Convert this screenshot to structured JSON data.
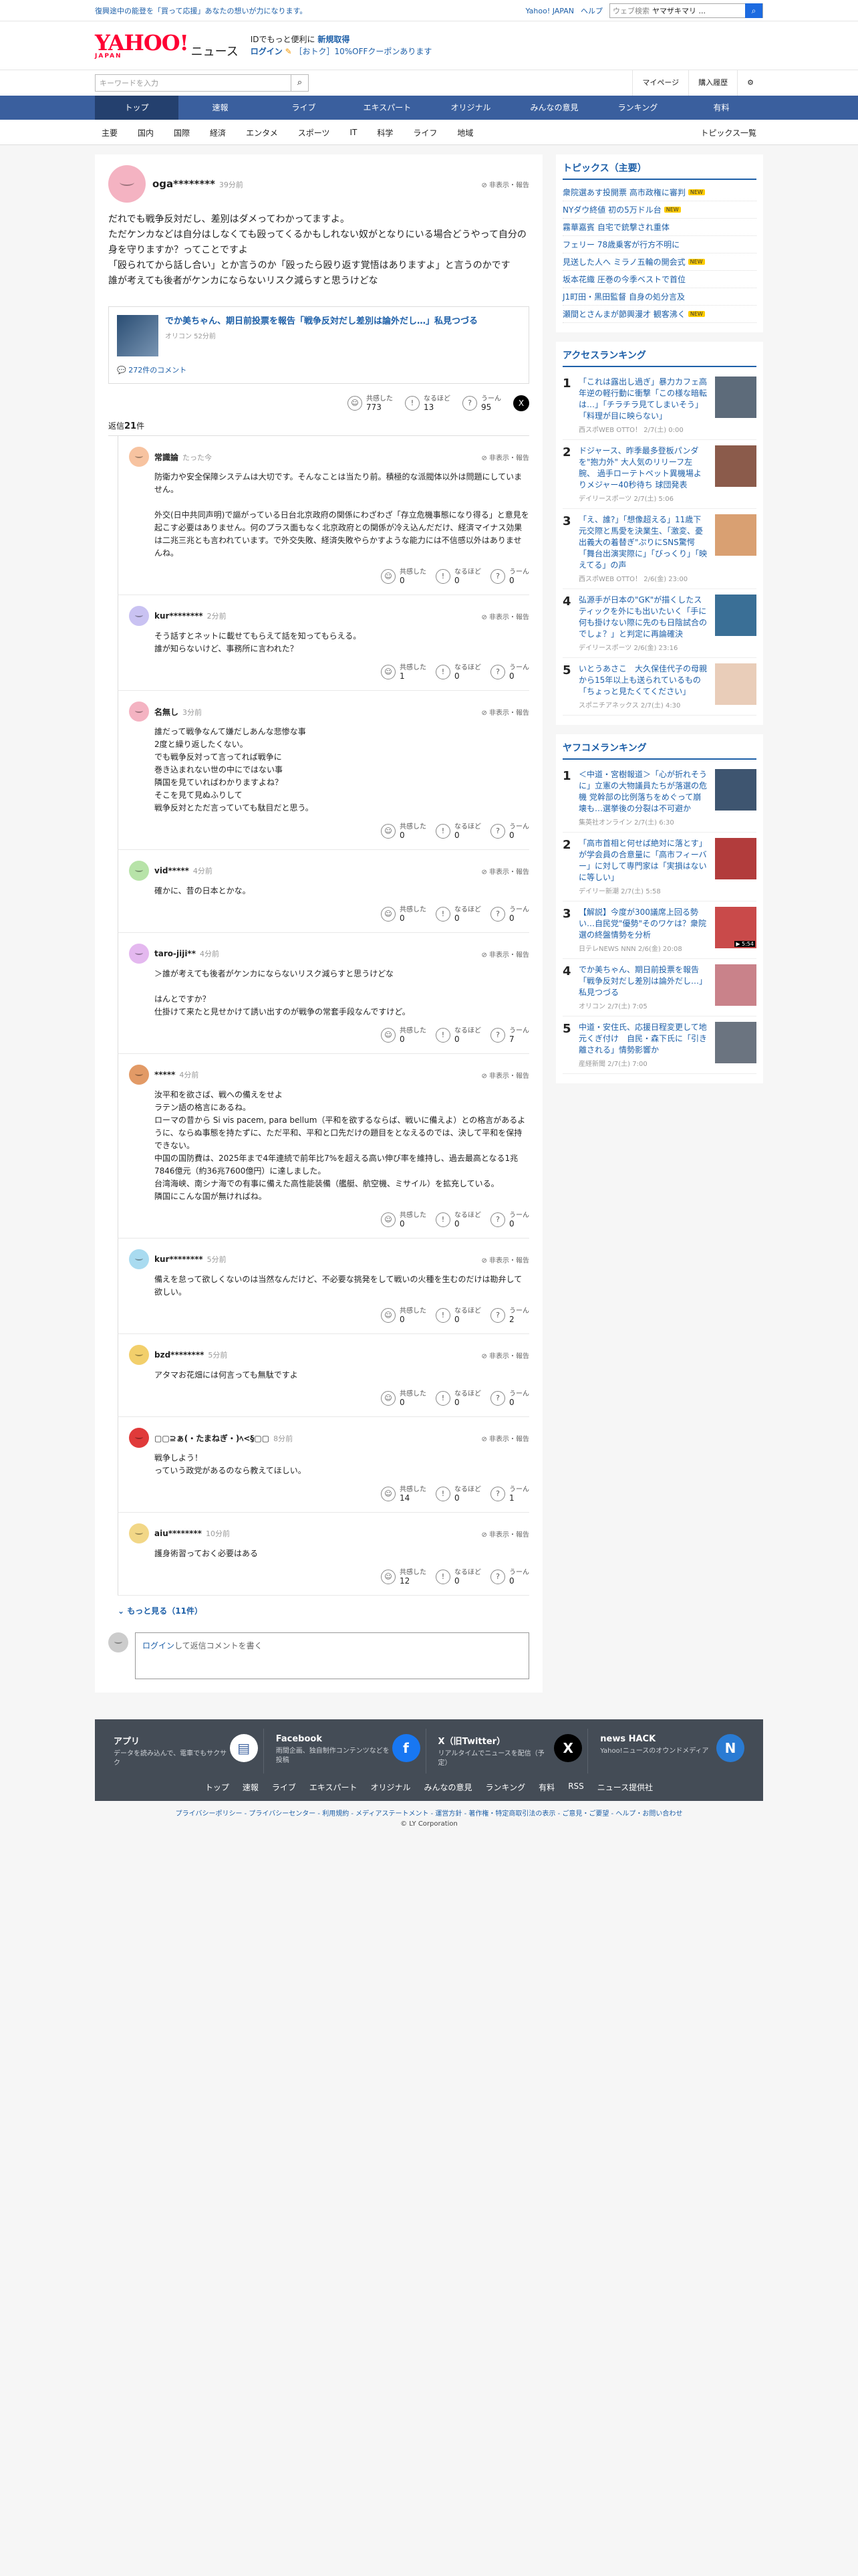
{
  "topstrip": {
    "notice": "復興途中の能登を「買って応援」あなたの想いが力になります。",
    "links": [
      "Yahoo! JAPAN",
      "ヘルプ"
    ],
    "web_search_label": "ウェブ検索",
    "web_search_value": "ヤマザキマリ ..."
  },
  "header": {
    "logo_text": "YAHOO!",
    "logo_sub": "JAPAN",
    "logo_news": "ニュース",
    "promo_line1": "IDでもっと便利に",
    "promo_new": "新規取得",
    "promo_login": "ログイン",
    "promo_coupon": "［おトク］10%OFFクーポンあります"
  },
  "search": {
    "placeholder": "キーワードを入力",
    "mypage": "マイページ",
    "purchase": "購入履歴"
  },
  "nav": {
    "tabs": [
      "トップ",
      "速報",
      "ライブ",
      "エキスパート",
      "オリジナル",
      "みんなの意見",
      "ランキング",
      "有料"
    ],
    "subtabs": [
      "主要",
      "国内",
      "国際",
      "経済",
      "エンタメ",
      "スポーツ",
      "IT",
      "科学",
      "ライフ",
      "地域"
    ],
    "topics_all": "トピックス一覧"
  },
  "comment": {
    "user": "oga********",
    "ago": "39分前",
    "report": "非表示・報告",
    "text": "だれでも戦争反対だし、差別はダメってわかってますよ。\nただケンカなどは自分はしなくても殴ってくるかもしれない奴がとなりにいる場合どうやって自分の身を守りますか？ってことですよ\n「殴られてから話し合い」とか言うのか「殴ったら殴り返す覚悟はありますよ」と言うのかです\n誰が考えても後者がケンカにならないリスク減らすと思うけどな",
    "article_title": "でか美ちゃん、期日前投票を報告「戦争反対だし差別は論外だし…」私見つづる",
    "article_source": "オリコン 52分前",
    "article_comments": "272件のコメント",
    "react_labels": [
      "共感した",
      "なるほど",
      "うーん"
    ],
    "react_counts": [
      "773",
      "13",
      "95"
    ]
  },
  "replies_header": {
    "prefix": "返信",
    "count": "21",
    "suffix": "件"
  },
  "replies": [
    {
      "user": "常識論",
      "ago": "たった今",
      "text": "防衛力や安全保障システムは大切です。そんなことは当たり前。積極的な派閥体以外は問題にしていません。\n\n外交(日中共同声明)で謳がっている日台北京政府の関係にわざわざ「存立危機事態になり得る」と意見を起こす必要はありません。何のプラス面もなく北京政府との関係が冷え込んだだけ、経済マイナス効果は二兆三兆とも言われています。で外交失敗、経済失敗やらかすような能力には不信感以外はありませんね。",
      "counts": [
        "0",
        "0",
        "0"
      ],
      "color": "#f7c3a0"
    },
    {
      "user": "kur********",
      "ago": "2分前",
      "text": "そう話すとネットに載せてもらえて話を知ってもらえる。\n誰が知らないけど、事務所に言われた？",
      "counts": [
        "1",
        "0",
        "0"
      ],
      "color": "#c9c2f2"
    },
    {
      "user": "名無し",
      "ago": "3分前",
      "text": "誰だって戦争なんて嫌だしあんな悲惨な事\n2度と繰り返したくない。\nでも戦争反対って言ってれば戦争に\n巻き込まれない世の中にではない事\n隣国を見ていればわかりますよね？\nそこを見て見ぬふりして\n戦争反対とただ言っていても駄目だと思う。",
      "counts": [
        "0",
        "0",
        "0"
      ],
      "color": "#f4b3c2"
    },
    {
      "user": "vid*****",
      "ago": "4分前",
      "text": "確かに、昔の日本とかな。",
      "counts": [
        "0",
        "0",
        "0"
      ],
      "color": "#b7e3a8"
    },
    {
      "user": "taro-jiji**",
      "ago": "4分前",
      "text": "＞誰が考えても後者がケンカにならないリスク減らすと思うけどな\n\nはんとですか？\n仕掛けて来たと見せかけて誘い出すのが戦争の常套手段なんですけど。",
      "counts": [
        "0",
        "0",
        "7"
      ],
      "color": "#e4b8ef"
    },
    {
      "user": "*****",
      "ago": "4分前",
      "text": "汝平和を欲さば、戦への備えをせよ\nラテン語の格言にあるね。\nローマの昔から Si vis pacem, para bellum（平和を欲するならば、戦いに備えよ）との格言があるように、ならぬ事態を持たずに、ただ平和、平和と口先だけの題目をとなえるのでは、決して平和を保持できない。\n中国の国防費は、2025年まで4年連続で前年比7%を超える高い伸び率を維持し、過去最高となる1兆7846億元（約36兆7600億円）に達しました。\n台湾海峡、南シナ海での有事に備えた高性能装備（艦艇、航空機、ミサイル）を拡充している。\n隣国にこんな国が無ければね。",
      "counts": [
        "0",
        "0",
        "0"
      ],
      "color": "#e29a66"
    },
    {
      "user": "kur********",
      "ago": "5分前",
      "text": "備えを怠って欲しくないのは当然なんだけど、不必要な挑発をして戦いの火種を生むのだけは勘弁して欲しい。",
      "counts": [
        "0",
        "0",
        "2"
      ],
      "color": "#a9dbf0"
    },
    {
      "user": "bzd********",
      "ago": "5分前",
      "text": "アタマお花畑には何言っても無駄ですよ",
      "counts": [
        "0",
        "0",
        "0"
      ],
      "color": "#f2cf6b"
    },
    {
      "user": "▢▢⊇ぁ(・たまねぎ・)ﾍ<§▢▢",
      "ago": "8分前",
      "text": "戦争しよう！\nっていう政党があるのなら教えてほしい。",
      "counts": [
        "14",
        "0",
        "1"
      ],
      "color": "#e03a3a"
    },
    {
      "user": "aiu********",
      "ago": "10分前",
      "text": "護身術習っておく必要はある",
      "counts": [
        "12",
        "0",
        "0"
      ],
      "color": "#f2d787"
    }
  ],
  "show_more": {
    "label": "もっと見る",
    "count": "（11件）"
  },
  "compose": {
    "login": "ログイン",
    "rest": "して返信コメントを書く"
  },
  "sidebar": {
    "topics_title": "トピックス（主要）",
    "topics": [
      {
        "t": "衆院選あす投開票 高市政権に審判",
        "new": true
      },
      {
        "t": "NYダウ終値 初の5万ドル台",
        "new": true
      },
      {
        "t": "霧華嘉賓 自宅で銃撃され重体",
        "new": false
      },
      {
        "t": "フェリー 78歳乗客が行方不明に",
        "new": false
      },
      {
        "t": "見送した人へ ミラノ五輪の開会式",
        "new": true
      },
      {
        "t": "坂本花織 圧巻の今季ベストで首位",
        "new": false
      },
      {
        "t": "J1町田・黒田監督 自身の処分言及",
        "new": false
      },
      {
        "t": "瀬間とさんまが節興漫才 観客沸く",
        "new": true
      }
    ],
    "new_label": "NEW",
    "access_title": "アクセスランキング",
    "access": [
      {
        "t": "「これは露出し過ぎ」暴力カフェ高年逆の軽行動に衝撃「この様な暗転は…」「チラチラ見てしまいそう」「料理が目に映らない」",
        "s": "西スポWEB OTTO！ 2/7(土) 0:00",
        "c": "#5d6b7a"
      },
      {
        "t": "ドジャース、昨季最多登板パンダを\"抱力外\" 大人気のリリーフ左腕、 過手ローテトペット異機場よりメジャー40秒待ち 球団発表",
        "s": "デイリースポーツ 2/7(土) 5:06",
        "c": "#8b5b4b"
      },
      {
        "t": "「え、誰?」「想像超える」11歳下元交際と馬愛を決業生、「激変、憂出義大の着替ぎ\"ぷりにSNS驚愕「舞台出演実際に」「びっくり」「映えてる」の声",
        "s": "西スポWEB OTTO！ 2/6(金) 23:00",
        "c": "#d9a072"
      },
      {
        "t": "弘源手が日本の\"GK\"が描くしたスティックを外にも出いたいく「手に何も掛けない際に先のも日陰試合のでしょ？」と判定に再論確決",
        "s": "デイリースポーツ 2/6(金) 23:16",
        "c": "#3a6f96"
      },
      {
        "t": "いとうあさこ　大久保佳代子の母親から15年以上も送られているもの「ちょっと見たくてください」",
        "s": "スポニチアネックス 2/7(土) 4:30",
        "c": "#e9cdb9"
      }
    ],
    "yahoo_title": "ヤフコメランキング",
    "yahoo": [
      {
        "t": "＜中道・宮樹報道＞「心が折れそうに」立憲の大物議員たちが落選の危機 党幹部の比例落ちをめぐって崩壊も…選挙後の分裂は不可避か",
        "s": "集英社オンライン 2/7(土) 6:30",
        "c": "#3e5570",
        "vid": ""
      },
      {
        "t": "「高市首相と何せば絶対に落とす」が学会員の合意量に「高市フィーバー」に対して専門家は「実損はないに等しい」",
        "s": "デイリー新潮 2/7(土) 5:58",
        "c": "#b23c3c",
        "vid": ""
      },
      {
        "t": "【解説】今度が300議席上回る勢い…自民党\"優勢\"そのワケは？衆院選の終盤情勢を分析",
        "s": "日テレNEWS NNN 2/6(金) 20:08",
        "c": "#c94a4a",
        "vid": "5:54"
      },
      {
        "t": "でか美ちゃん、期日前投票を報告「戦争反対だし差別は論外だし…」私見つづる",
        "s": "オリコン 2/7(土) 7:05",
        "c": "#c9828a",
        "vid": ""
      },
      {
        "t": "中道・安住氏、応援日程変更して地元くぎ付け　自民・森下氏に「引き離される」情勢影響か",
        "s": "産経新聞 2/7(土) 7:00",
        "c": "#6b7480",
        "vid": ""
      }
    ]
  },
  "footer": {
    "blocks": [
      {
        "t": "アプリ",
        "d": "データを読み込んで、電車でもサクサク",
        "icon": "app-icon"
      },
      {
        "t": "Facebook",
        "d": "雨間企画、独自制作コンテンツなどを投稿",
        "icon": "facebook-icon"
      },
      {
        "t": "X（旧Twitter）",
        "d": "リアルタイムでニュースを配信（予定）",
        "icon": "x-icon"
      },
      {
        "t": "news HACK",
        "d": "Yahoo!ニュースのオウンドメディア",
        "icon": "newshack-icon"
      }
    ],
    "links": [
      "トップ",
      "速報",
      "ライブ",
      "エキスパート",
      "オリジナル",
      "みんなの意見",
      "ランキング",
      "有料",
      "RSS",
      "ニュース提供社"
    ],
    "legal": "プライバシーポリシー - プライバシーセンター - 利用規約 - メディアステートメント - 運営方針 - 著作権・特定商取引法の表示 - ご意見・ご要望 - ヘルプ・お問い合わせ",
    "copyright": "© LY Corporation"
  },
  "colors": {
    "brand": "#ff0033",
    "nav": "#3a5f9e",
    "link": "#1d5fa8"
  }
}
